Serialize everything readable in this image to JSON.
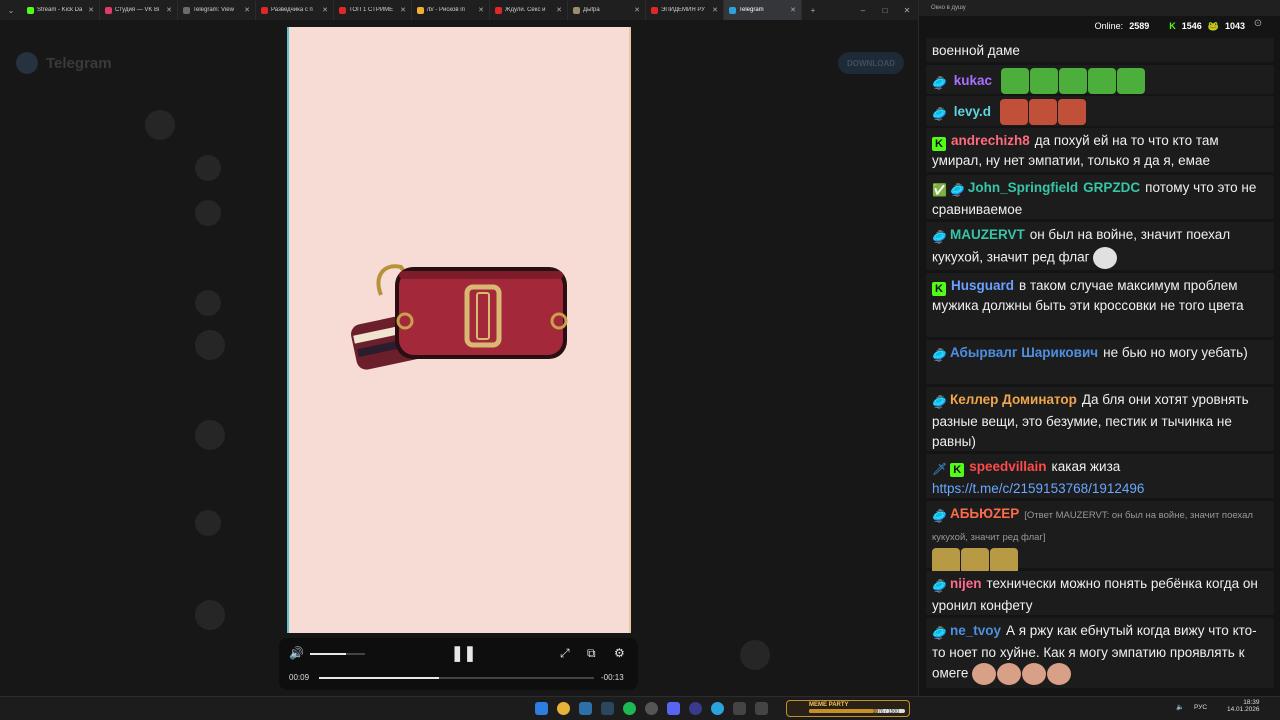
{
  "browser": {
    "tabs": [
      {
        "title": "Stream - Kick Da",
        "color": "#53fc18"
      },
      {
        "title": "Студия — VK Ві",
        "color": "#e03a6b"
      },
      {
        "title": "Telegram: View",
        "color": "#6b6b6b"
      },
      {
        "title": "Разведчика с п",
        "color": "#e02828"
      },
      {
        "title": "ТОП 1 СТРИМЕ",
        "color": "#e02828"
      },
      {
        "title": "/b/ - Рисков іп",
        "color": "#f0b030"
      },
      {
        "title": "Ждули. Секс и",
        "color": "#e02828"
      },
      {
        "title": "Дыfра",
        "color": "#9a8d6a"
      },
      {
        "title": "ЭПИДЕМИЯ РУ",
        "color": "#e02828"
      },
      {
        "title": "Telegram",
        "color": "#2aa3df",
        "active": true
      }
    ],
    "new_tab": "+",
    "close_glyph": "✕"
  },
  "telegram_bg": {
    "brand": "Telegram",
    "download": "DOWNLOAD"
  },
  "player": {
    "time_current": "00:09",
    "time_remaining": "-00:13",
    "progress_fraction": 0.435,
    "volume_fraction": 0.65
  },
  "chat": {
    "window_title": "Окно в душу",
    "online_label": "Online:",
    "online": "2589",
    "kick_count": "1546",
    "other_count": "1043",
    "messages": [
      {
        "text": "военной даме"
      },
      {
        "user": "kukac",
        "user_color": "#a970ff",
        "text": ""
      },
      {
        "user": "levy.d",
        "user_color": "#5fd3e0",
        "text": ""
      },
      {
        "user": "andrechizh8",
        "user_color": "#ff6b7d",
        "text": "да похуй ей на то что кто там умирал, ну нет эмпатии, только я да я, емае"
      },
      {
        "user": "John_Springfield",
        "user_color": "#36c5a6",
        "extra": "GRPZDC",
        "text": "потому что это не сравниваемое"
      },
      {
        "user": "MAUZERVT",
        "user_color": "#36c5a6",
        "text": "он был на войне, значит поехал кукухой, значит ред флаг"
      },
      {
        "user": "Husguard",
        "user_color": "#6aa0ff",
        "text": "в таком случае максимум проблем мужика должны быть эти кроссовки не того цвета"
      },
      {
        "user": "Абырвалг Шарикович",
        "user_color": "#4f8fe0",
        "text": "не бью но могу уебать)"
      },
      {
        "user": "Келлер Доминатор",
        "user_color": "#f0a64a",
        "text": "Да бля они хотят уровнять разные вещи, это безумие, пестик и тычинка не равны)"
      },
      {
        "user": "speedvillain",
        "user_color": "#ff4a4a",
        "text": "какая жиза",
        "link": "https://t.me/c/2159153768/1912496"
      },
      {
        "user": "АБЬЮZEP",
        "user_color": "#ff6b4a",
        "reply": "[Ответ MAUZERVT: он был на войне, значит поехал кукухой, значит ред флаг]"
      },
      {
        "user": "nijen",
        "user_color": "#ff6b8a",
        "text": "технически можно понять ребёнка когда он уронил конфету"
      },
      {
        "user": "ne_tvoy",
        "user_color": "#4f8fe0",
        "text": "А я ржу как ебнутый когда вижу что кто-то ноет по хуйне. Как я могу эмпатию проявлять к омеге"
      }
    ]
  },
  "taskbar": {
    "game_label": "MEME PARTY",
    "game_progress_text": "1076 / 1500",
    "game_progress_fraction": 0.717,
    "lang": "РУС",
    "time": "18:39",
    "date": "14.01.2026"
  }
}
